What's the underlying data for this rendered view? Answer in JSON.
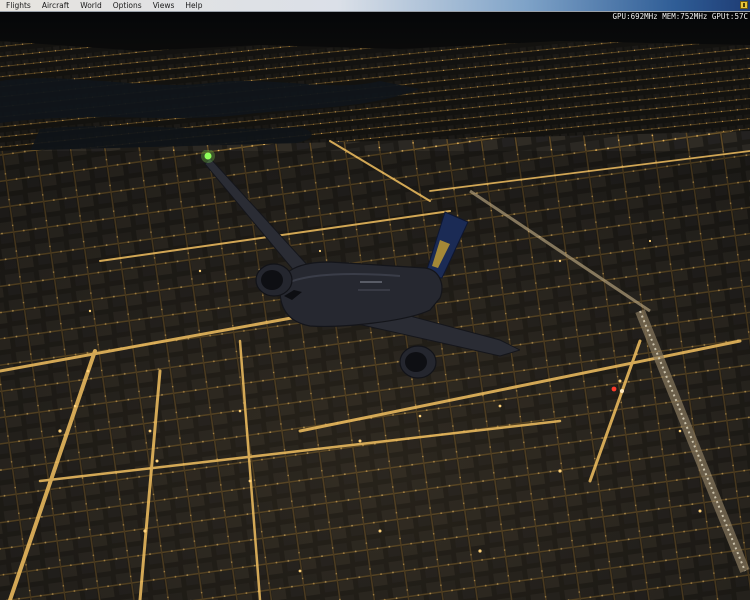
{
  "menubar": {
    "items": [
      "Flights",
      "Aircraft",
      "World",
      "Options",
      "Views",
      "Help"
    ]
  },
  "hud": {
    "gpu": "GPU:692MHz",
    "mem": "MEM:752MHz",
    "gpu_util": "GPUt:57C"
  },
  "scene": {
    "description_colors": {
      "sky": "#0b0b0a",
      "water": "#10171c",
      "city_light": "#d9a040",
      "street_glow": "#f2c060"
    }
  }
}
